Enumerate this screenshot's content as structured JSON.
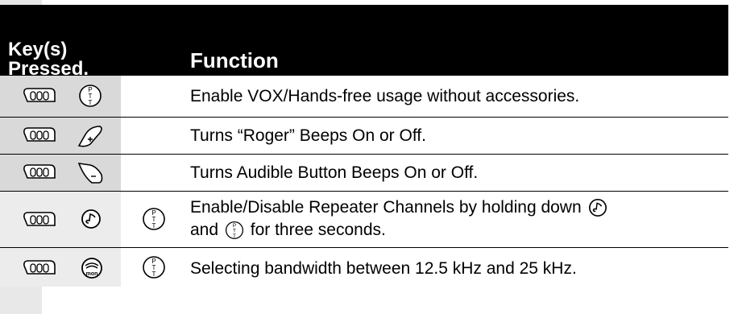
{
  "header": {
    "keys_line1": "Key(s)",
    "keys_line2": "Pressed.",
    "function": "Function"
  },
  "rows": [
    {
      "keys": [
        "menu-icon",
        "ptt-icon"
      ],
      "function": "Enable VOX/Hands-free usage without accessories."
    },
    {
      "keys": [
        "menu-icon",
        "plus-icon"
      ],
      "function": "Turns “Roger” Beeps On or Off."
    },
    {
      "keys": [
        "menu-icon",
        "minus-icon"
      ],
      "function": "Turns Audible Button Beeps On or Off."
    },
    {
      "keys": [
        "menu-icon",
        "call-icon",
        "ptt-icon"
      ],
      "function_line1_a": "Enable/Disable Repeater Channels by holding down",
      "function_line2_a": "and",
      "function_line2_b": "for three seconds."
    },
    {
      "keys": [
        "menu-icon",
        "mon-icon",
        "ptt-icon"
      ],
      "function": "Selecting bandwidth between 12.5 kHz and 25 kHz."
    }
  ],
  "icon_labels": {
    "ptt": [
      "P",
      "T",
      "T"
    ],
    "mon": "mon"
  }
}
